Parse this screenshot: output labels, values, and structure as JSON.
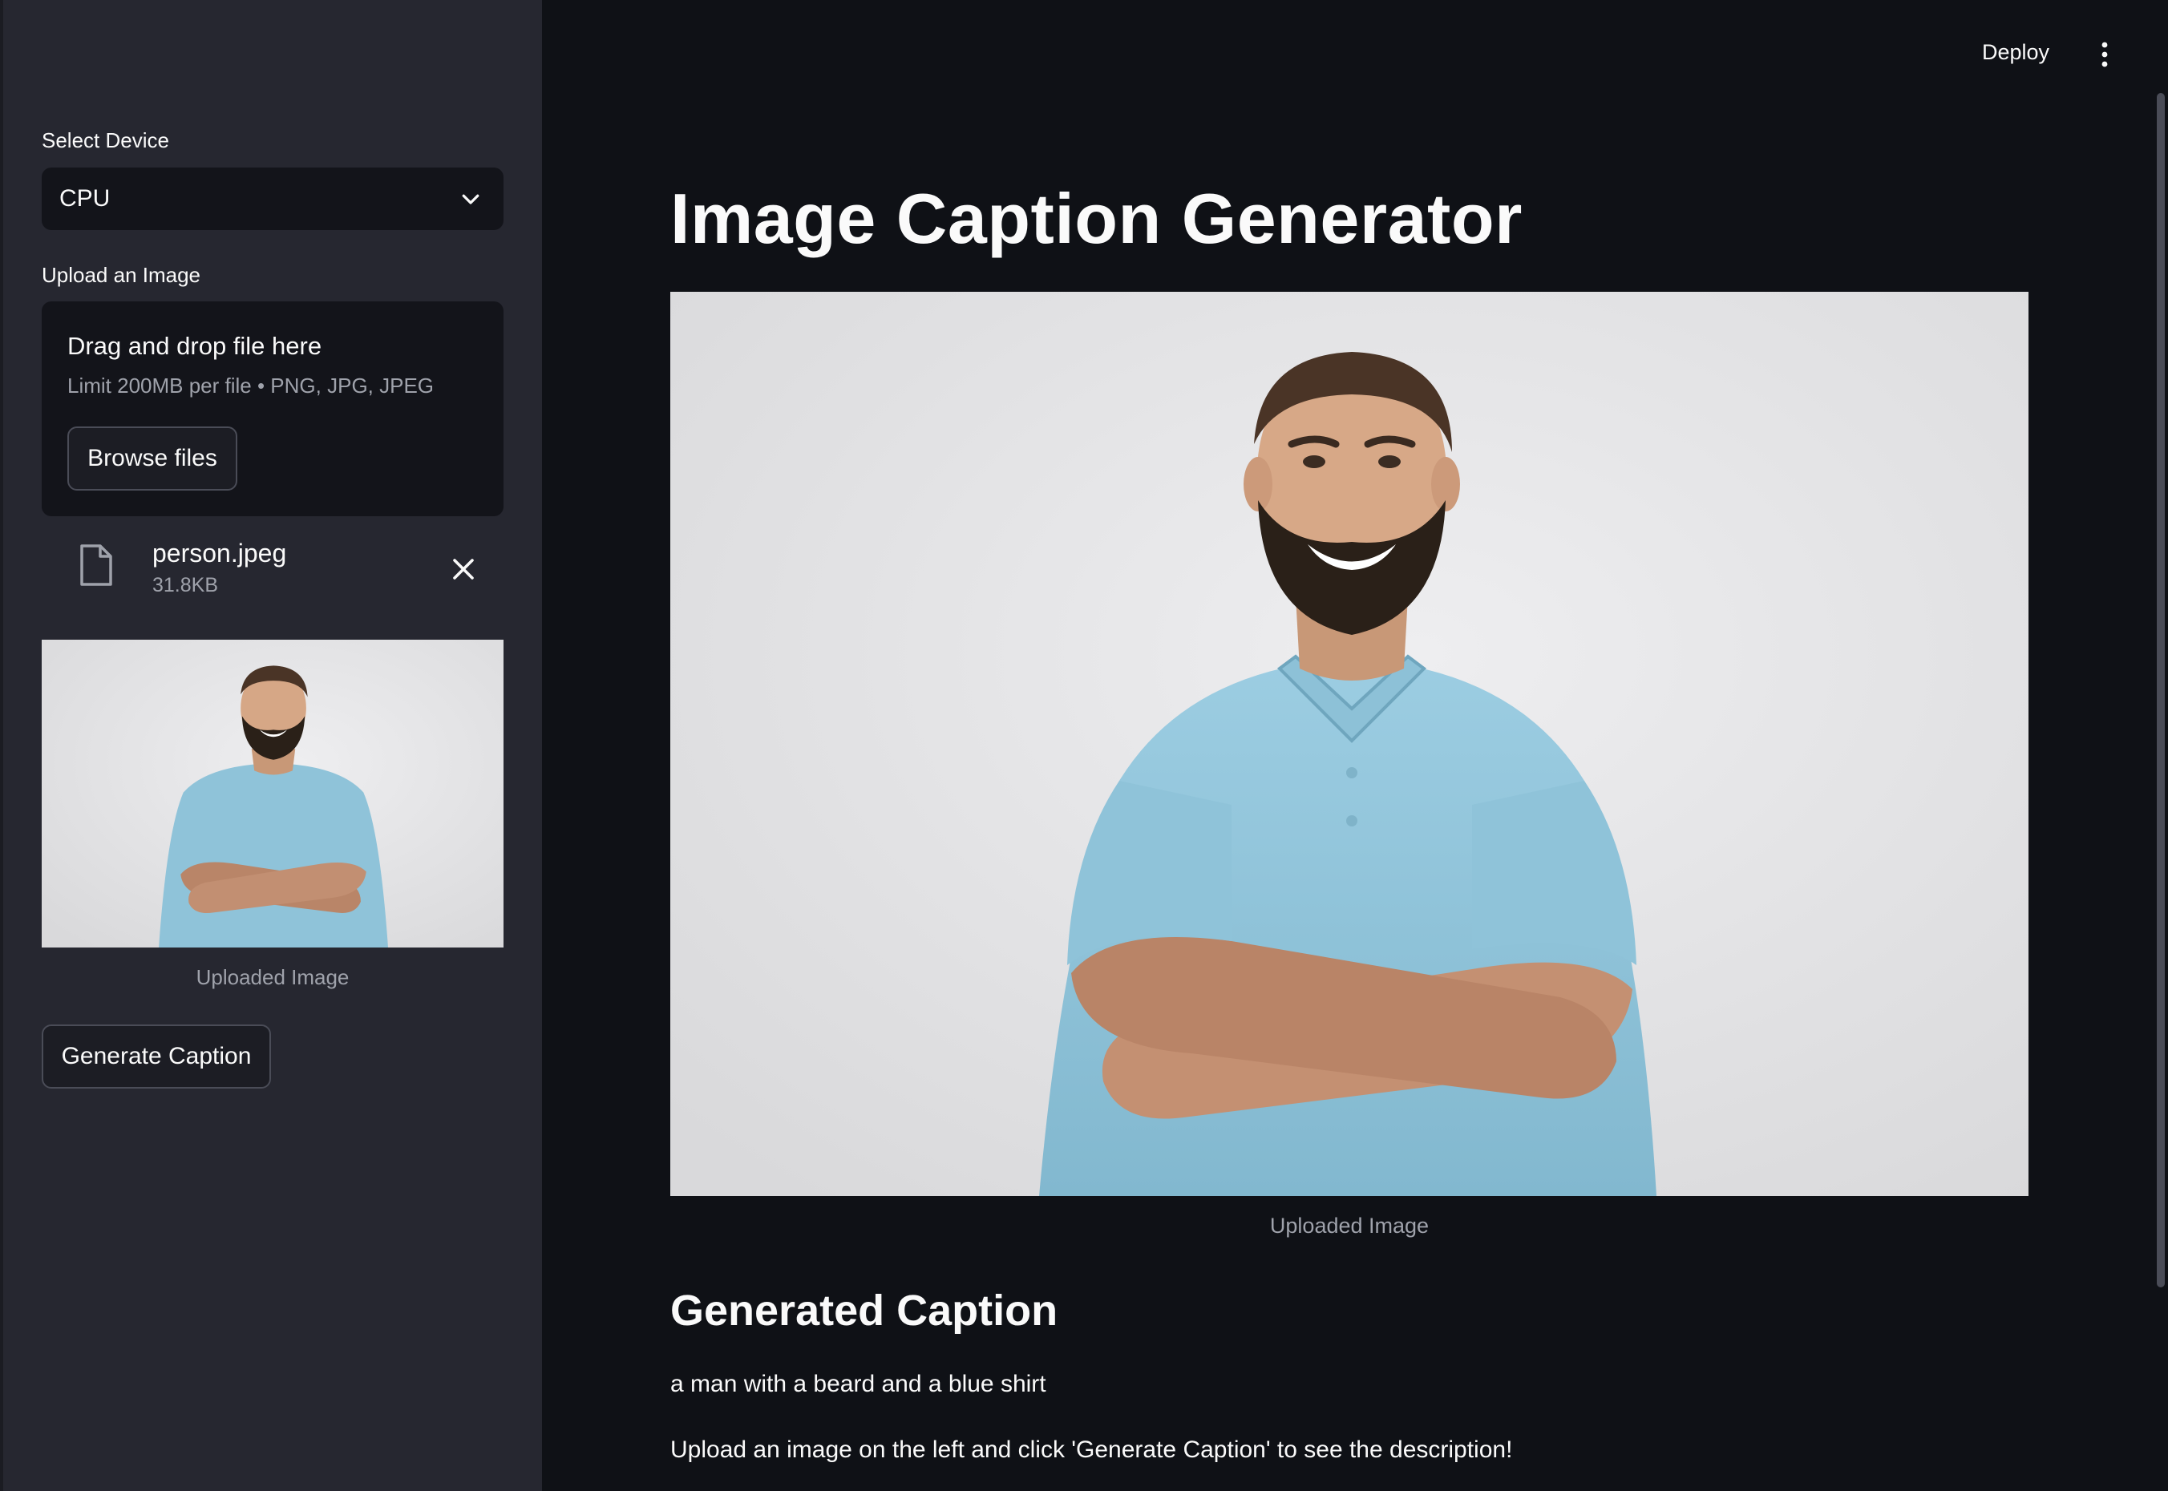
{
  "sidebar": {
    "device_label": "Select Device",
    "device_value": "CPU",
    "upload_label": "Upload an Image",
    "dropzone": {
      "title": "Drag and drop file here",
      "subtitle": "Limit 200MB per file • PNG, JPG, JPEG",
      "browse_label": "Browse files"
    },
    "file": {
      "name": "person.jpeg",
      "size": "31.8KB"
    },
    "thumbnail_caption": "Uploaded Image",
    "generate_label": "Generate Caption"
  },
  "header": {
    "deploy_label": "Deploy"
  },
  "main": {
    "title": "Image Caption Generator",
    "image_caption": "Uploaded Image",
    "section_title": "Generated Caption",
    "generated_caption": "a man with a beard and a blue shirt",
    "instruction": "Upload an image on the left and click 'Generate Caption' to see the description!"
  },
  "colors": {
    "app_background": "#0f1116",
    "sidebar_background": "#262730",
    "input_background": "#13141a",
    "shirt_blue": "#8fc3d9"
  }
}
